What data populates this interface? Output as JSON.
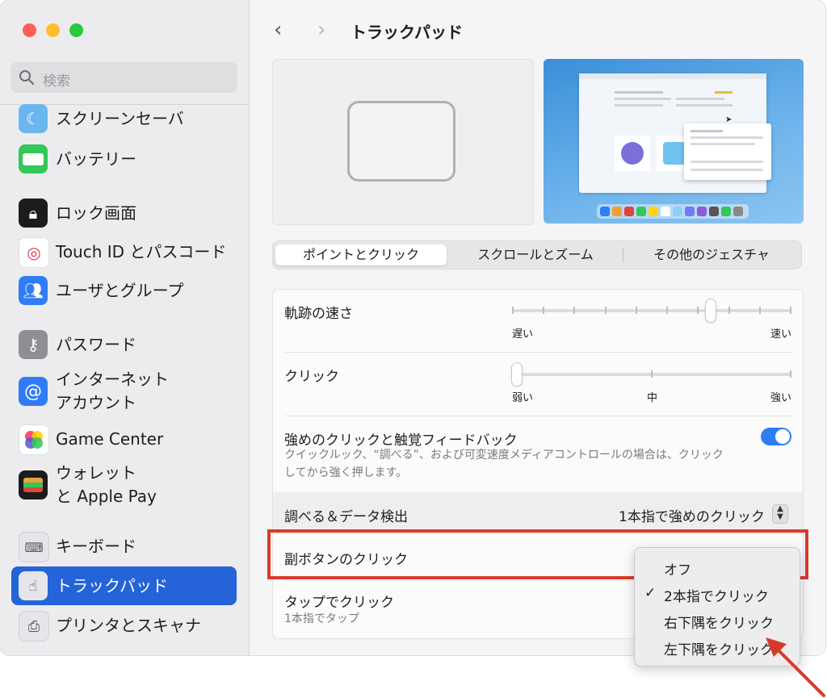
{
  "sidebar": {
    "search_placeholder": "検索",
    "items": [
      {
        "label": "スクリーンセーバ",
        "icon": "screensaver-icon",
        "color": "#6cb6ee"
      },
      {
        "label": "バッテリー",
        "icon": "battery-icon",
        "color": "#34c759"
      },
      {
        "label": "ロック画面",
        "icon": "lock-icon",
        "color": "#1c1c1e"
      },
      {
        "label": "Touch ID とパスコード",
        "icon": "fingerprint-icon",
        "color": "#ffffff"
      },
      {
        "label": "ユーザとグループ",
        "icon": "users-icon",
        "color": "#2f7cf6"
      },
      {
        "label": "パスワード",
        "icon": "key-icon",
        "color": "#8e8e93"
      },
      {
        "label_line1": "インターネット",
        "label_line2": "アカウント",
        "icon": "at-icon",
        "color": "#2f7cf6"
      },
      {
        "label": "Game Center",
        "icon": "game-center-icon",
        "color": "#ffffff"
      },
      {
        "label_line1": "ウォレット",
        "label_line2": "と Apple Pay",
        "icon": "wallet-icon",
        "color": "#1c1c1e"
      },
      {
        "label": "キーボード",
        "icon": "keyboard-icon",
        "color": "#e5e5ea"
      },
      {
        "label": "トラックパッド",
        "icon": "trackpad-icon",
        "color": "#e5e5ea",
        "active": true
      },
      {
        "label": "プリンタとスキャナ",
        "icon": "printer-icon",
        "color": "#e5e5ea"
      }
    ]
  },
  "header": {
    "back": "‹",
    "forward": "›",
    "title": "トラックパッド"
  },
  "tabs": [
    "ポイントとクリック",
    "スクロールとズーム",
    "その他のジェスチャ"
  ],
  "settings": {
    "tracking_speed": {
      "label": "軌跡の速さ",
      "min_label": "遅い",
      "max_label": "速い",
      "value": 0.72,
      "ticks": 10
    },
    "click": {
      "label": "クリック",
      "min_label": "弱い",
      "mid_label": "中",
      "max_label": "強い",
      "value": 0.0,
      "ticks": 3
    },
    "force_click": {
      "label": "強めのクリックと触覚フィードバック",
      "sub_line1": "クイックルック、“調べる”、および可変速度メディアコントロールの場合は、クリック",
      "sub_line2": "してから強く押します。",
      "enabled": true
    },
    "lookup": {
      "label": "調べる＆データ検出",
      "value": "1本指で強めのクリック"
    },
    "secondary_click": {
      "label": "副ボタンのクリック"
    },
    "tap_to_click": {
      "label": "タップでクリック",
      "sub": "1本指でタップ"
    }
  },
  "dropdown": {
    "options": [
      "オフ",
      "2本指でクリック",
      "右下隅をクリック",
      "左下隅をクリック"
    ],
    "selected": "2本指でクリック",
    "check": "✓"
  },
  "colors": {
    "accent": "#2563d8",
    "annotation": "#d93a2b"
  }
}
